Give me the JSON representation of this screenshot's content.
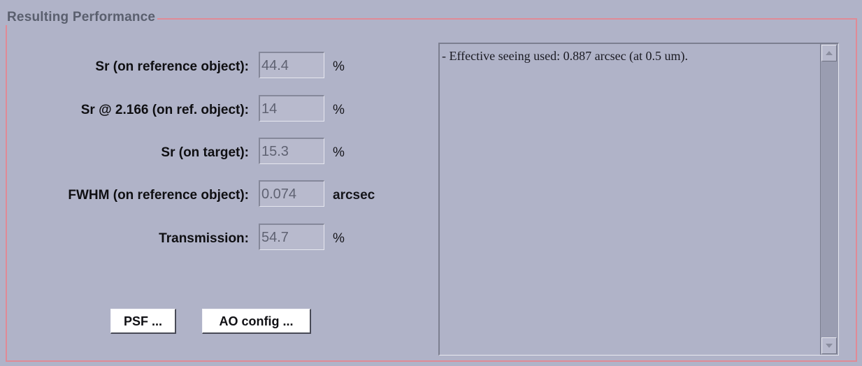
{
  "panel": {
    "title": "Resulting Performance"
  },
  "rows": [
    {
      "label": "Sr (on reference object):",
      "value": "44.4",
      "unit": "%"
    },
    {
      "label": "Sr @ 2.166 (on ref. object):",
      "value": "14",
      "unit": "%"
    },
    {
      "label": "Sr (on target):",
      "value": "15.3",
      "unit": "%"
    },
    {
      "label": "FWHM (on reference object):",
      "value": "0.074",
      "unit": "arcsec"
    },
    {
      "label": "Transmission:",
      "value": "54.7",
      "unit": "%"
    }
  ],
  "buttons": {
    "psf": "PSF ...",
    "ao_config": "AO config ..."
  },
  "output": {
    "text": "- Effective seeing used: 0.887 arcsec (at 0.5 um)."
  },
  "icons": {
    "scroll_up": "scroll-up-arrow-icon",
    "scroll_down": "scroll-down-arrow-icon"
  },
  "colors": {
    "background": "#b0b3c8",
    "border_accent": "#e08a96"
  }
}
